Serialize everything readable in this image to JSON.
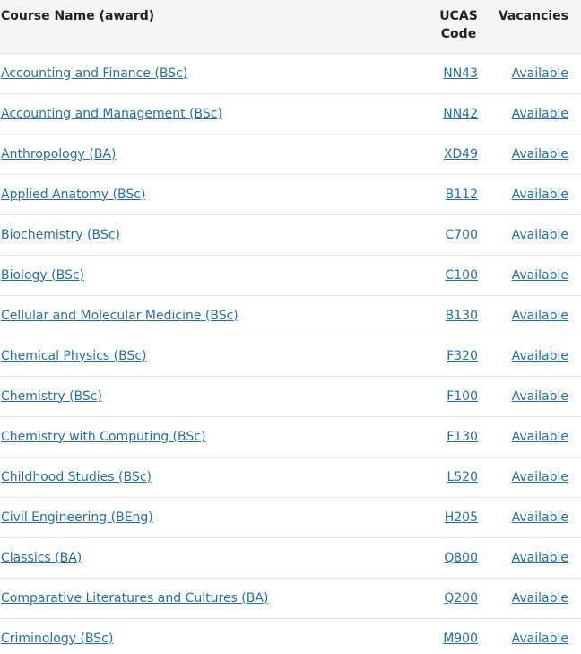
{
  "table": {
    "headers": {
      "name": "Course Name (award)",
      "code_line1": "UCAS",
      "code_line2": "Code",
      "vacancies": "Vacancies"
    },
    "rows": [
      {
        "name": "Accounting and Finance (BSc)",
        "code": "NN43",
        "vacancies": "Available"
      },
      {
        "name": "Accounting and Management (BSc)",
        "code": "NN42",
        "vacancies": "Available"
      },
      {
        "name": "Anthropology (BA)",
        "code": "XD49",
        "vacancies": "Available"
      },
      {
        "name": "Applied Anatomy (BSc)",
        "code": "B112",
        "vacancies": "Available"
      },
      {
        "name": "Biochemistry (BSc)",
        "code": "C700",
        "vacancies": "Available"
      },
      {
        "name": "Biology (BSc)",
        "code": "C100",
        "vacancies": "Available"
      },
      {
        "name": "Cellular and Molecular Medicine (BSc)",
        "code": "B130",
        "vacancies": "Available"
      },
      {
        "name": "Chemical Physics (BSc)",
        "code": "F320",
        "vacancies": "Available"
      },
      {
        "name": "Chemistry (BSc)",
        "code": "F100",
        "vacancies": "Available"
      },
      {
        "name": "Chemistry with Computing (BSc)",
        "code": "F130",
        "vacancies": "Available"
      },
      {
        "name": "Childhood Studies (BSc)",
        "code": "L520",
        "vacancies": "Available"
      },
      {
        "name": "Civil Engineering (BEng)",
        "code": "H205",
        "vacancies": "Available"
      },
      {
        "name": "Classics (BA)",
        "code": "Q800",
        "vacancies": "Available"
      },
      {
        "name": "Comparative Literatures and Cultures (BA)",
        "code": "Q200",
        "vacancies": "Available"
      },
      {
        "name": "Criminology (BSc)",
        "code": "M900",
        "vacancies": "Available"
      }
    ]
  },
  "colors": {
    "link": "#2a6f97",
    "header_bg": "#f5f5f5",
    "row_border": "#e6e6e6"
  }
}
